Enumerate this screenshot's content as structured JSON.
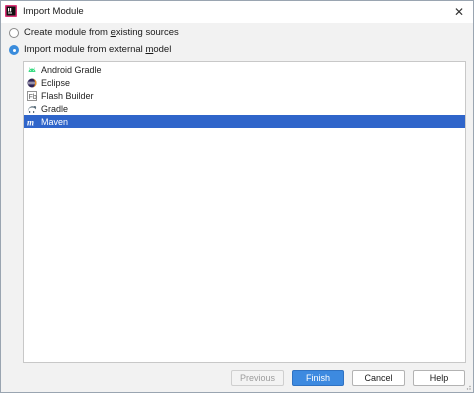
{
  "window": {
    "title": "Import Module",
    "close_symbol": "✕"
  },
  "options": {
    "existing_sources": {
      "prefix": "Create module from ",
      "mnemonic": "e",
      "suffix": "xisting sources",
      "selected": false
    },
    "external_model": {
      "prefix": "Import module from external ",
      "mnemonic": "m",
      "suffix": "odel",
      "selected": true
    }
  },
  "models": [
    {
      "label": "Android Gradle",
      "icon": "android-icon",
      "selected": false
    },
    {
      "label": "Eclipse",
      "icon": "eclipse-icon",
      "selected": false
    },
    {
      "label": "Flash Builder",
      "icon": "flash-builder-icon",
      "selected": false
    },
    {
      "label": "Gradle",
      "icon": "gradle-icon",
      "selected": false
    },
    {
      "label": "Maven",
      "icon": "maven-icon",
      "selected": true
    }
  ],
  "buttons": {
    "previous": "Previous",
    "finish": "Finish",
    "cancel": "Cancel",
    "help": "Help"
  },
  "colors": {
    "selection": "#2f65ca",
    "primary_button": "#3d8ae0"
  }
}
